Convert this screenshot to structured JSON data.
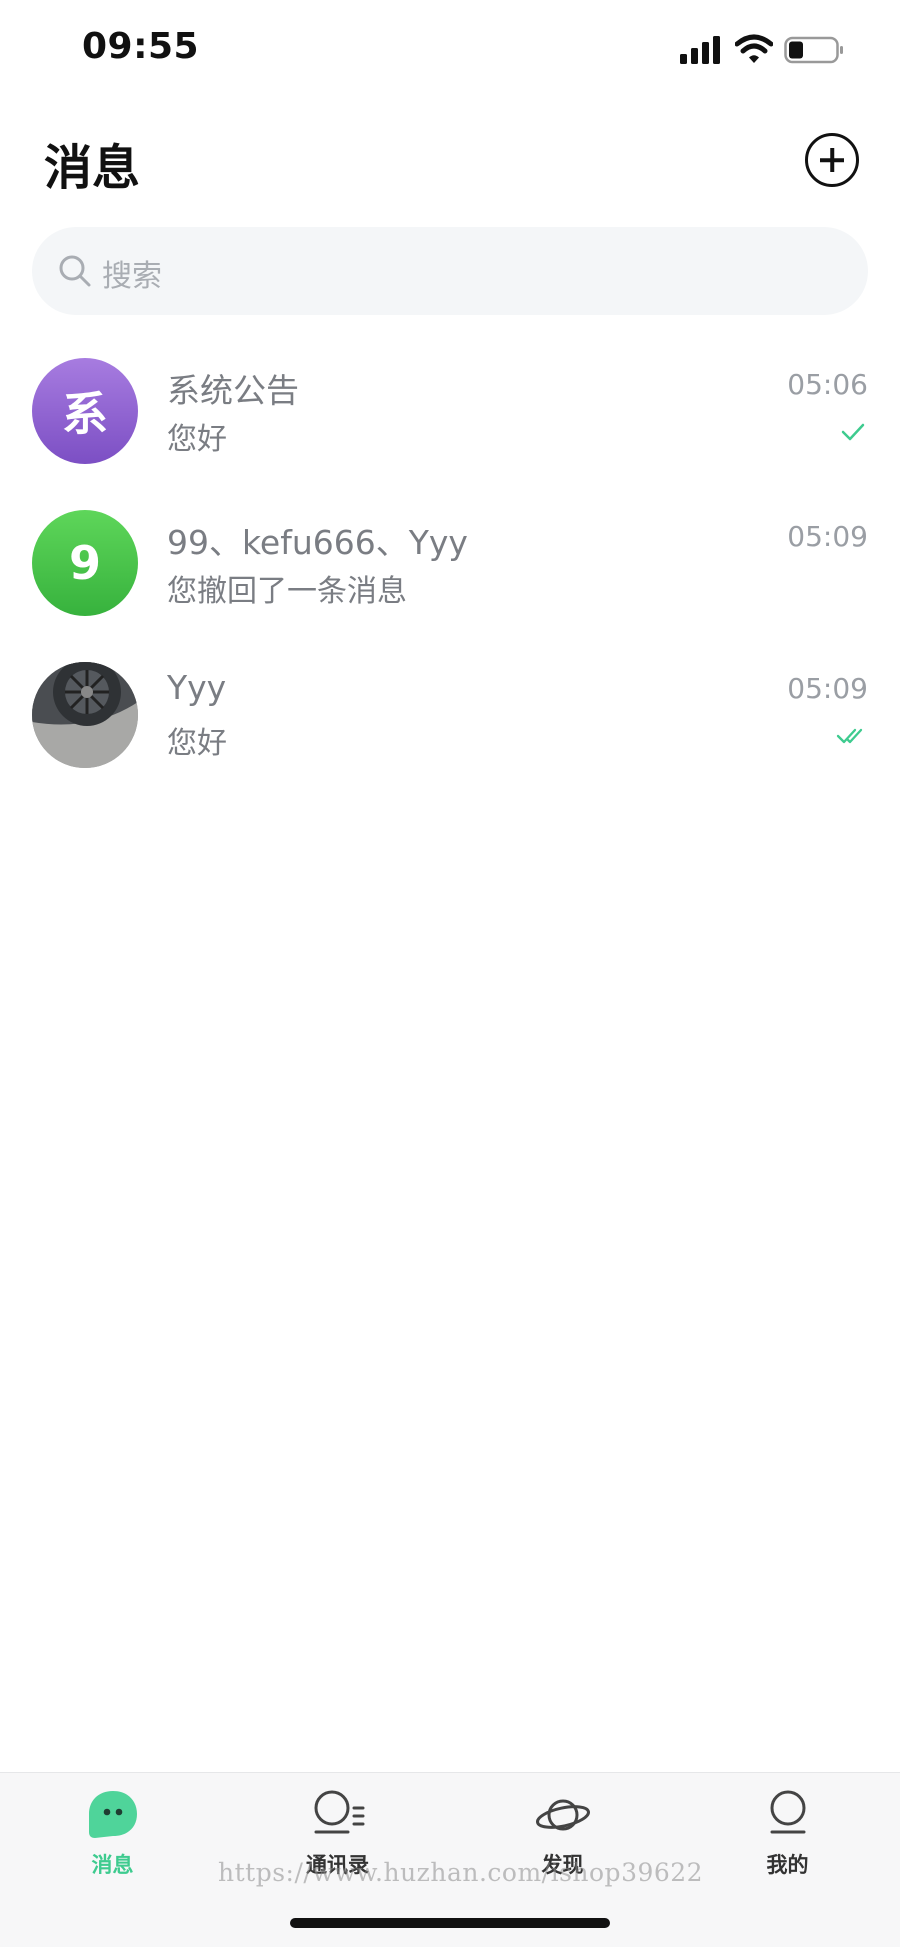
{
  "status_bar": {
    "time": "09:55",
    "icons": [
      "signal-icon",
      "wifi-icon",
      "battery-icon"
    ]
  },
  "header": {
    "title": "消息",
    "add_icon": "plus-circle-icon"
  },
  "search": {
    "placeholder": "搜索",
    "icon": "search-icon"
  },
  "conversations": [
    {
      "avatar_text": "系",
      "avatar_color": "#8e61d2",
      "name": "系统公告",
      "preview": "您好",
      "time": "05:06",
      "status": "sent-check-icon"
    },
    {
      "avatar_text": "9",
      "avatar_color": "#45c447",
      "name": "99、kefu666、Yyy",
      "preview": "您撤回了一条消息",
      "time": "05:09",
      "status": ""
    },
    {
      "avatar_text": "",
      "avatar_color": "",
      "name": "Yyy",
      "preview": "您好",
      "time": "05:09",
      "status": "read-double-check-icon"
    }
  ],
  "tab_bar": {
    "tabs": [
      {
        "label": "消息",
        "icon": "chat-bubble-icon",
        "active": true
      },
      {
        "label": "通讯录",
        "icon": "contacts-icon",
        "active": false
      },
      {
        "label": "发现",
        "icon": "planet-icon",
        "active": false
      },
      {
        "label": "我的",
        "icon": "user-icon",
        "active": false
      }
    ]
  },
  "watermark": "https://www.huzhan.com/ishop39622",
  "colors": {
    "accent": "#3ecb8f",
    "check": "#3ecb8f",
    "text_secondary": "#7a7d83"
  }
}
